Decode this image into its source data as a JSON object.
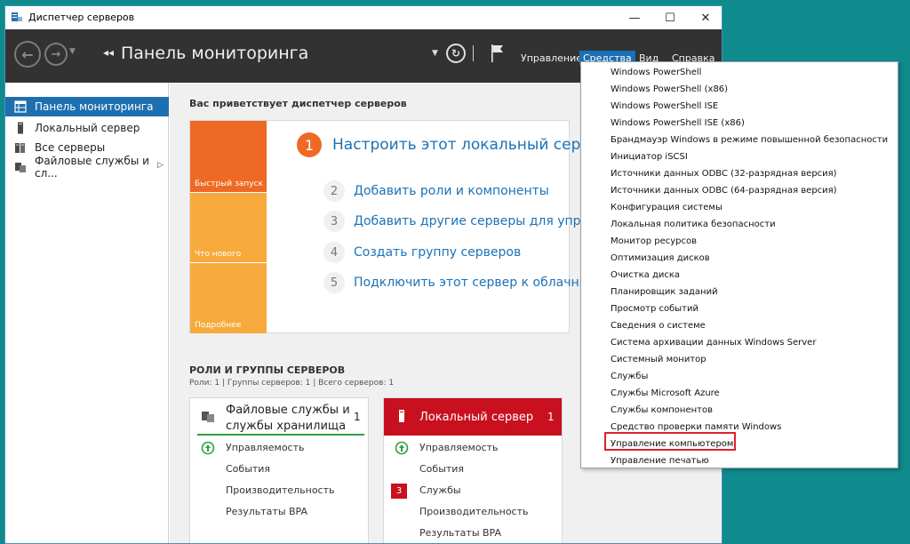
{
  "window": {
    "title": "Диспетчер серверов",
    "controls": {
      "minimize": "—",
      "maximize": "☐",
      "close": "✕"
    }
  },
  "toolbar": {
    "page_title": "Панель мониторинга",
    "breadcrumb_arrows": "◂◂",
    "menus": [
      "Управление",
      "Средства",
      "Вид",
      "Справка"
    ],
    "active_menu": "Средства"
  },
  "sidebar": {
    "items": [
      {
        "label": "Панель мониторинга",
        "icon": "dashboard-icon",
        "active": true
      },
      {
        "label": "Локальный сервер",
        "icon": "server-icon",
        "active": false
      },
      {
        "label": "Все серверы",
        "icon": "servers-icon",
        "active": false
      },
      {
        "label": "Файловые службы и сл...",
        "icon": "file-services-icon",
        "active": false
      }
    ]
  },
  "welcome": {
    "heading": "Вас приветствует диспетчер серверов",
    "tiles": [
      "Быстрый запуск",
      "Что нового",
      "Подробнее"
    ],
    "main_step": {
      "num": "1",
      "text": "Настроить этот локальный серв"
    },
    "steps": [
      {
        "num": "2",
        "text": "Добавить роли и компоненты"
      },
      {
        "num": "3",
        "text": "Добавить другие серверы для управ"
      },
      {
        "num": "4",
        "text": "Создать группу серверов"
      },
      {
        "num": "5",
        "text": "Подключить этот сервер к облачным"
      }
    ]
  },
  "roles": {
    "heading": "РОЛИ И ГРУППЫ СЕРВЕРОВ",
    "subheading": "Роли: 1 | Группы серверов: 1 | Всего серверов: 1",
    "cards": [
      {
        "title_line1": "Файловые службы и",
        "title_line2": "службы хранилища",
        "count": "1",
        "rows": [
          "Управляемость",
          "События",
          "Производительность",
          "Результаты BPA"
        ]
      },
      {
        "title": "Локальный сервер",
        "count": "1",
        "badge": "3",
        "rows": [
          "Управляемость",
          "События",
          "Службы",
          "Производительность",
          "Результаты BPA"
        ]
      }
    ]
  },
  "tools_menu": {
    "items": [
      "Windows PowerShell",
      "Windows PowerShell (x86)",
      "Windows PowerShell ISE",
      "Windows PowerShell ISE (x86)",
      "Брандмауэр Windows в режиме повышенной безопасности",
      "Инициатор iSCSI",
      "Источники данных ODBC (32-разрядная версия)",
      "Источники данных ODBC (64-разрядная версия)",
      "Конфигурация системы",
      "Локальная политика безопасности",
      "Монитор ресурсов",
      "Оптимизация дисков",
      "Очистка диска",
      "Планировщик заданий",
      "Просмотр событий",
      "Сведения о системе",
      "Система архивации данных Windows Server",
      "Системный монитор",
      "Службы",
      "Службы Microsoft Azure",
      "Службы компонентов",
      "Средство проверки памяти Windows",
      "Управление компьютером",
      "Управление печатью"
    ],
    "highlighted": "Управление компьютером"
  },
  "colors": {
    "toolbar_bg": "#323232",
    "accent_blue": "#1e6fb0",
    "quick_start_orange": "#ee6a24",
    "tile_orange": "#f6aa3c",
    "local_server_red": "#c8101f",
    "highlight_red": "#e02030",
    "desktop_teal": "#0f8b8d"
  }
}
